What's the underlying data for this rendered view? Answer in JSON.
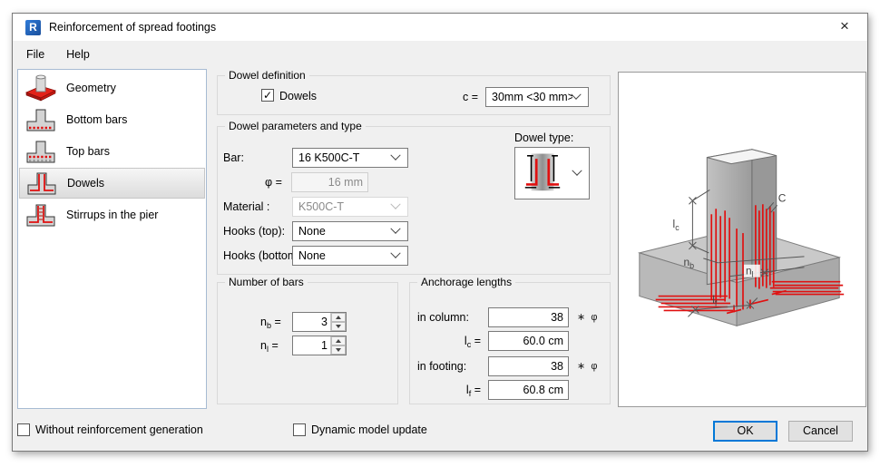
{
  "window": {
    "title": "Reinforcement of spread footings",
    "app_letter": "R",
    "close_glyph": "×"
  },
  "menu": {
    "items": [
      {
        "label": "File"
      },
      {
        "label": "Help"
      }
    ]
  },
  "sidebar": {
    "items": [
      {
        "label": "Geometry",
        "selected": false
      },
      {
        "label": "Bottom bars",
        "selected": false
      },
      {
        "label": "Top bars",
        "selected": false
      },
      {
        "label": "Dowels",
        "selected": true
      },
      {
        "label": "Stirrups in the pier",
        "selected": false
      }
    ]
  },
  "dowel_definition": {
    "title": "Dowel definition",
    "dowels_label": "Dowels",
    "dowels_checked_glyph": "✓",
    "c_label": "c =",
    "c_value": "30mm <30 mm>"
  },
  "dowel_params": {
    "title": "Dowel parameters and type",
    "bar_label": "Bar:",
    "bar_value": "16 K500C-T",
    "phi_label": "φ =",
    "phi_value": "16 mm",
    "material_label": "Material :",
    "material_value": "K500C-T",
    "hooks_top_label": "Hooks (top):",
    "hooks_top_value": "None",
    "hooks_bottom_label": "Hooks (bottom):",
    "hooks_bottom_value": "None",
    "dowel_type_label": "Dowel type:"
  },
  "number_of_bars": {
    "title": "Number of bars",
    "nb_base": "n",
    "nb_sub": "b",
    "nb_eq": "=",
    "nb_value": "3",
    "nl_base": "n",
    "nl_sub": "l",
    "nl_eq": "=",
    "nl_value": "1"
  },
  "anchorage": {
    "title": "Anchorage lengths",
    "in_column_label": "in column:",
    "in_column_value": "38",
    "in_footing_label": "in footing:",
    "in_footing_value": "38",
    "times_glyph": "∗",
    "phi_glyph": "φ",
    "lc_base": "l",
    "lc_sub": "c",
    "lc_eq": "=",
    "lc_value": "60.0 cm",
    "lf_base": "l",
    "lf_sub": "f",
    "lf_eq": "=",
    "lf_value": "60.8 cm"
  },
  "preview": {
    "lc_base": "l",
    "lc_sub": "c",
    "c_label": "C",
    "nb_base": "n",
    "nb_sub": "b",
    "nl_base": "n",
    "nl_sub": "l",
    "lf_base": "l",
    "lf_sub": "f"
  },
  "footer": {
    "without_label": "Without reinforcement generation",
    "dynamic_label": "Dynamic model update",
    "ok_label": "OK",
    "cancel_label": "Cancel"
  },
  "colors": {
    "accent": "#0078d7",
    "rebar_red": "#e01010",
    "dialog_bg": "#f0f0f0"
  }
}
